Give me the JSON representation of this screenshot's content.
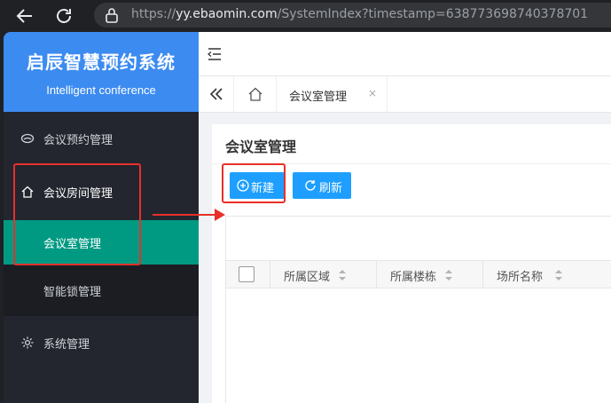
{
  "browser": {
    "url_host": "yy.ebaomin.com",
    "url_rest": "/SystemIndex?timestamp=638773698740378701",
    "url_scheme": "https://"
  },
  "sidebar": {
    "brand_title": "启辰智慧预约系统",
    "brand_subtitle": "Intelligent conference",
    "items": [
      {
        "label": "会议预约管理",
        "icon": "chat-bubble-icon"
      },
      {
        "label": "会议房间管理",
        "icon": "home-icon",
        "expanded": true,
        "children": [
          {
            "label": "会议室管理",
            "active": true
          },
          {
            "label": "智能锁管理"
          }
        ]
      },
      {
        "label": "系统管理",
        "icon": "gear-icon"
      }
    ]
  },
  "tabs": [
    {
      "label": "会议室管理",
      "close": "×"
    }
  ],
  "main": {
    "title": "会议室管理",
    "buttons": {
      "new": "新建",
      "refresh": "刷新"
    },
    "table": {
      "columns": [
        "所属区域",
        "所属楼栋",
        "场所名称"
      ]
    }
  },
  "colors": {
    "brand": "#3c8bf0",
    "sidebar": "#23262e",
    "active": "#009a82",
    "primary_button": "#1e9fff",
    "annotation": "#e8302a"
  }
}
